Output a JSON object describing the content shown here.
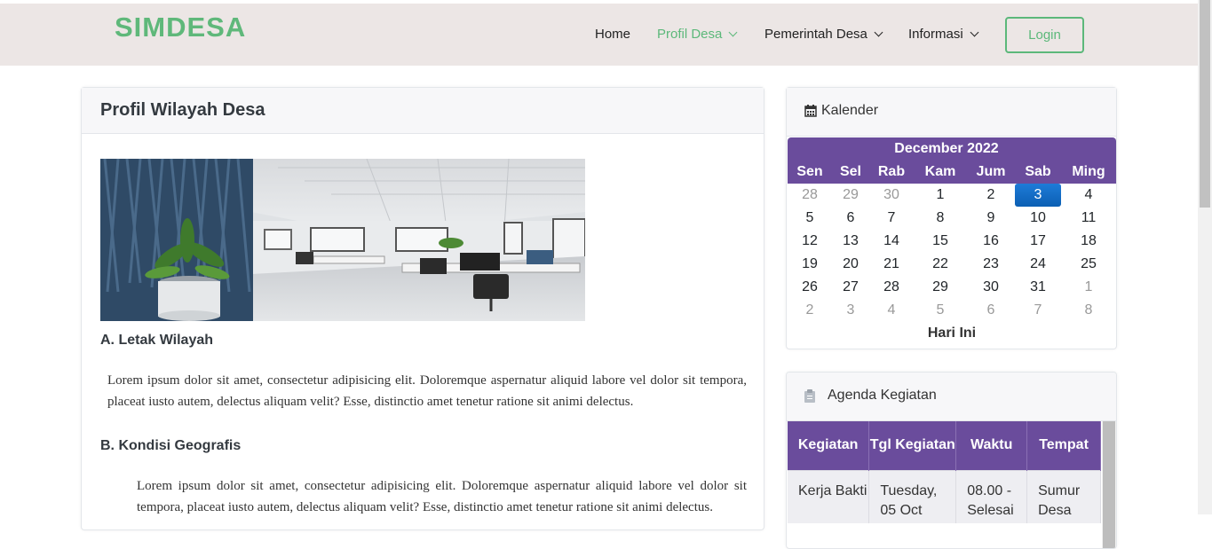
{
  "navbar": {
    "brand": "SIMDESA",
    "items": [
      {
        "label": "Home"
      },
      {
        "label": "Profil Desa"
      },
      {
        "label": "Pemerintah Desa"
      },
      {
        "label": "Informasi"
      }
    ],
    "login": "Login",
    "brand_color": "#5fb87a",
    "active_color": "#5cb87a"
  },
  "main": {
    "title": "Profil Wilayah Desa",
    "sections": [
      {
        "title": "A. Letak Wilayah",
        "text": "Lorem ipsum dolor sit amet, consectetur adipisicing elit. Doloremque aspernatur aliquid labore vel dolor sit tempora, placeat iusto autem, delectus aliquam velit? Esse, distinctio amet tenetur ratione sit animi delectus."
      },
      {
        "title": "B. Kondisi Geografis",
        "text": "Lorem ipsum dolor sit amet, consectetur adipisicing elit. Doloremque aspernatur aliquid labore vel dolor sit tempora, placeat iusto autem, delectus aliquam velit? Esse, distinctio amet tenetur ratione sit animi delectus."
      }
    ]
  },
  "calendar": {
    "header": "Kalender",
    "month": "December 2022",
    "days": [
      "Sen",
      "Sel",
      "Rab",
      "Kam",
      "Jum",
      "Sab",
      "Ming"
    ],
    "weeks": [
      [
        "28",
        "29",
        "30",
        "1",
        "2",
        "3",
        "4"
      ],
      [
        "5",
        "6",
        "7",
        "8",
        "9",
        "10",
        "11"
      ],
      [
        "12",
        "13",
        "14",
        "15",
        "16",
        "17",
        "18"
      ],
      [
        "19",
        "20",
        "21",
        "22",
        "23",
        "24",
        "25"
      ],
      [
        "26",
        "27",
        "28",
        "29",
        "30",
        "31",
        "1"
      ],
      [
        "2",
        "3",
        "4",
        "5",
        "6",
        "7",
        "8"
      ]
    ],
    "today": "Hari Ini",
    "header_color": "#6a4c9c"
  },
  "agenda": {
    "header": "Agenda Kegiatan",
    "columns": [
      "Kegiatan",
      "Tgl Kegiatan",
      "Waktu",
      "Tempat"
    ],
    "rows": [
      [
        "Kerja Bakti",
        "Tuesday, 05 Oct",
        "08.00 - Selesai",
        "Sumur Desa"
      ]
    ]
  }
}
